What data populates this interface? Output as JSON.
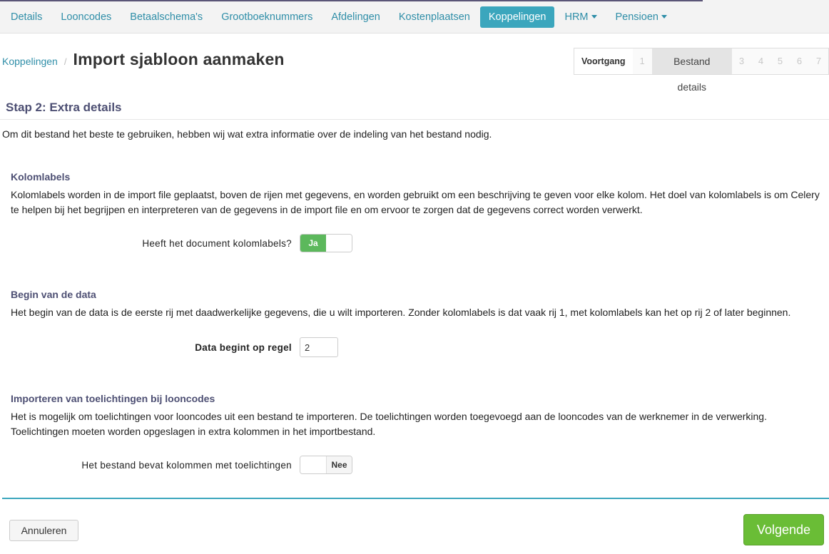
{
  "nav": {
    "items": [
      {
        "label": "Details"
      },
      {
        "label": "Looncodes"
      },
      {
        "label": "Betaalschema's"
      },
      {
        "label": "Grootboeknummers"
      },
      {
        "label": "Afdelingen"
      },
      {
        "label": "Kostenplaatsen"
      },
      {
        "label": "Koppelingen",
        "active": true
      },
      {
        "label": "HRM",
        "dropdown": true
      },
      {
        "label": "Pensioen",
        "dropdown": true
      }
    ]
  },
  "breadcrumb": {
    "parent": "Koppelingen",
    "separator": "/",
    "title": "Import sjabloon aanmaken"
  },
  "progress": {
    "label": "Voortgang",
    "steps": [
      "1",
      "Bestand details",
      "3",
      "4",
      "5",
      "6",
      "7"
    ],
    "current_step": 2
  },
  "step_title": "Stap 2: Extra details",
  "intro": "Om dit bestand het beste te gebruiken, hebben wij wat extra informatie over de indeling van het bestand nodig.",
  "sections": {
    "kolomlabels": {
      "title": "Kolomlabels",
      "text": "Kolomlabels worden in de import file geplaatst, boven de rijen met gegevens, en worden gebruikt om een beschrijving te geven voor elke kolom. Het doel van kolomlabels is om Celery te helpen bij het begrijpen en interpreteren van de gegevens in de import file en om ervoor te zorgen dat de gegevens correct worden verwerkt.",
      "field_label": "Heeft het document kolomlabels?",
      "toggle_label": "Ja"
    },
    "begin": {
      "title": "Begin van de data",
      "text": "Het begin van de data is de eerste rij met daadwerkelijke gegevens, die u wilt importeren. Zonder kolomlabels is dat vaak rij 1, met kolomlabels kan het op rij 2 of later beginnen.",
      "field_label": "Data begint op regel",
      "value": "2"
    },
    "toelichtingen": {
      "title": "Importeren van toelichtingen bij looncodes",
      "text": "Het is mogelijk om toelichtingen voor looncodes uit een bestand te importeren. De toelichtingen worden toegevoegd aan de looncodes van de werknemer in de verwerking. Toelichtingen moeten worden opgeslagen in extra kolommen in het importbestand.",
      "field_label": "Het bestand bevat kolommen met toelichtingen",
      "toggle_label": "Nee"
    }
  },
  "footer": {
    "cancel_label": "Annuleren",
    "next_label": "Volgende"
  },
  "colors": {
    "accent": "#3ba6bd",
    "link": "#2f8ea8",
    "success": "#5cb85c",
    "next": "#6abd36",
    "heading": "#4d4f73"
  }
}
